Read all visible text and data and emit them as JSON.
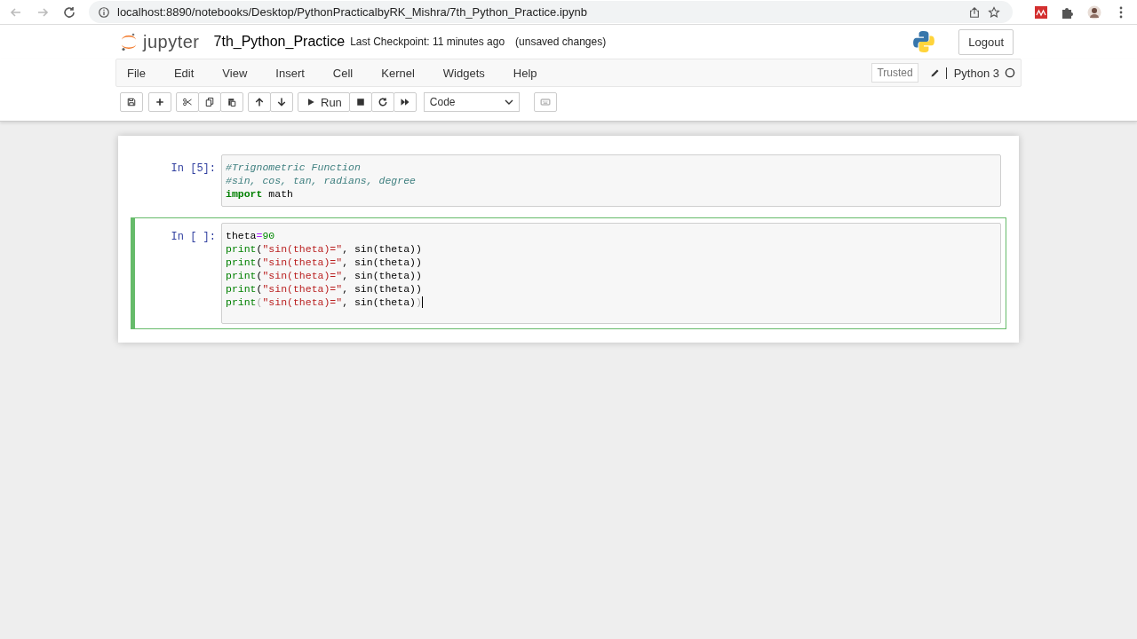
{
  "browser": {
    "url": "localhost:8890/notebooks/Desktop/PythonPracticalbyRK_Mishra/7th_Python_Practice.ipynb"
  },
  "header": {
    "logo_text": "jupyter",
    "notebook_name": "7th_Python_Practice",
    "checkpoint": "Last Checkpoint: 11 minutes ago",
    "autosave_status": "(unsaved changes)",
    "logout": "Logout"
  },
  "menu": [
    "File",
    "Edit",
    "View",
    "Insert",
    "Cell",
    "Kernel",
    "Widgets",
    "Help"
  ],
  "trusted": "Trusted",
  "kernel": {
    "name": "Python 3",
    "busy": false
  },
  "toolbar": {
    "run": "Run",
    "cell_type": "Code"
  },
  "cells": [
    {
      "prompt": "In [5]:",
      "selected": false,
      "lines": [
        [
          {
            "kind": "comment",
            "text": "#Trignometric Function"
          }
        ],
        [
          {
            "kind": "comment",
            "text": "#sin, cos, tan, radians, degree"
          }
        ],
        [
          {
            "kind": "keyword",
            "text": "import"
          },
          {
            "kind": "plain",
            "text": " math"
          }
        ]
      ]
    },
    {
      "prompt": "In [ ]:",
      "selected": true,
      "lines": [
        [
          {
            "kind": "plain",
            "text": "theta"
          },
          {
            "kind": "operator",
            "text": "="
          },
          {
            "kind": "number",
            "text": "90"
          }
        ],
        [
          {
            "kind": "builtin",
            "text": "print"
          },
          {
            "kind": "plain",
            "text": "("
          },
          {
            "kind": "string",
            "text": "\"sin(theta)=\""
          },
          {
            "kind": "plain",
            "text": ", sin(theta))"
          }
        ],
        [
          {
            "kind": "builtin",
            "text": "print"
          },
          {
            "kind": "plain",
            "text": "("
          },
          {
            "kind": "string",
            "text": "\"sin(theta)=\""
          },
          {
            "kind": "plain",
            "text": ", sin(theta))"
          }
        ],
        [
          {
            "kind": "builtin",
            "text": "print"
          },
          {
            "kind": "plain",
            "text": "("
          },
          {
            "kind": "string",
            "text": "\"sin(theta)=\""
          },
          {
            "kind": "plain",
            "text": ", sin(theta))"
          }
        ],
        [
          {
            "kind": "builtin",
            "text": "print"
          },
          {
            "kind": "plain",
            "text": "("
          },
          {
            "kind": "string",
            "text": "\"sin(theta)=\""
          },
          {
            "kind": "plain",
            "text": ", sin(theta))"
          }
        ],
        [
          {
            "kind": "builtin",
            "text": "print"
          },
          {
            "kind": "matched",
            "text": "("
          },
          {
            "kind": "string",
            "text": "\"sin(theta)=\""
          },
          {
            "kind": "plain",
            "text": ", sin(theta)"
          },
          {
            "kind": "matched",
            "text": ")"
          }
        ]
      ]
    }
  ]
}
